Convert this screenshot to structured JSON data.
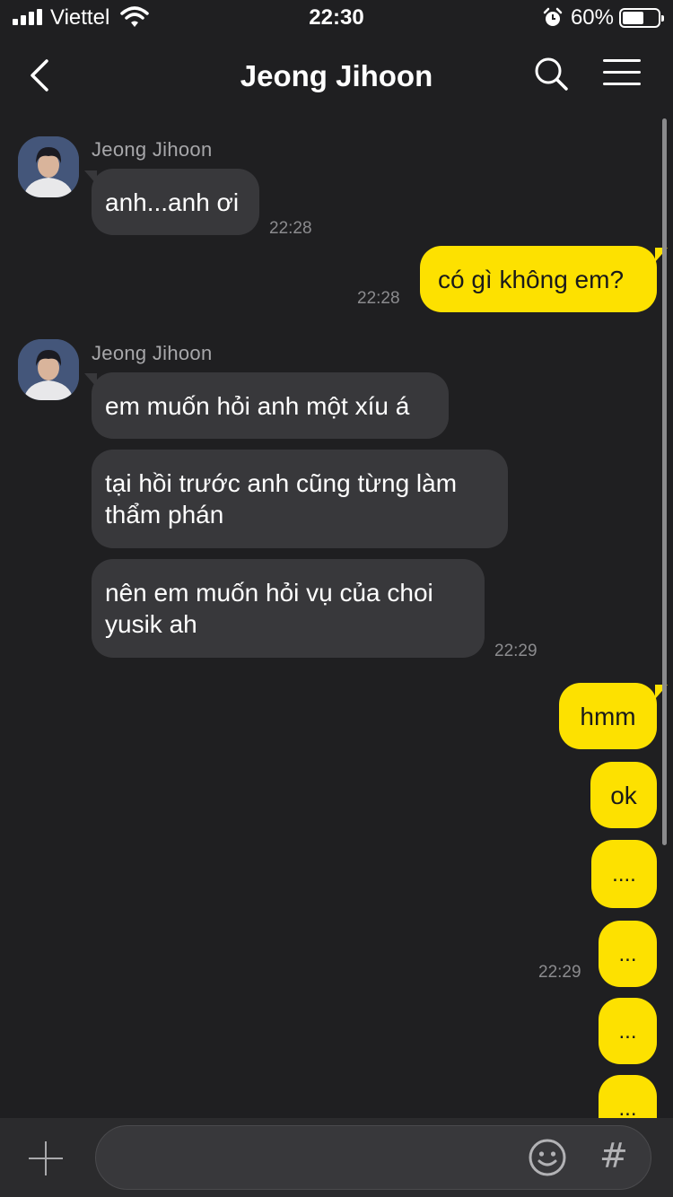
{
  "status_bar": {
    "carrier": "Viettel",
    "time": "22:30",
    "battery_percent": "60%",
    "battery_level": 0.6,
    "icons": [
      "signal-icon",
      "wifi-icon",
      "alarm-icon",
      "battery-icon"
    ]
  },
  "header": {
    "title": "Jeong Jihoon",
    "icons": [
      "back-arrow-icon",
      "search-icon",
      "menu-icon"
    ]
  },
  "messages": [
    {
      "sender": "Jeong Jihoon",
      "direction": "in",
      "text": "anh...anh ơi",
      "time": "22:28"
    },
    {
      "direction": "out",
      "text": "có gì không em?",
      "time": "22:28"
    },
    {
      "sender": "Jeong Jihoon",
      "direction": "in",
      "text": "em muốn hỏi anh một xíu á"
    },
    {
      "direction": "in",
      "text": "tại hồi trước anh cũng từng làm thẩm phán"
    },
    {
      "direction": "in",
      "text": "nên em muốn hỏi vụ của choi yusik ah",
      "time": "22:29"
    },
    {
      "direction": "out",
      "text": "hmm"
    },
    {
      "direction": "out",
      "text": "ok"
    },
    {
      "direction": "out",
      "text": "...."
    },
    {
      "direction": "out",
      "text": "...",
      "time": "22:29"
    },
    {
      "direction": "out",
      "text": "..."
    },
    {
      "direction": "out",
      "text": "..."
    }
  ],
  "input_bar": {
    "placeholder": "",
    "icons": [
      "plus-icon",
      "emoji-icon",
      "hashtag-icon"
    ],
    "hashtag_glyph": "#"
  },
  "colors": {
    "background": "#1f1f21",
    "incoming_bubble": "#38383b",
    "outgoing_bubble": "#fde100",
    "timestamp": "#8b8b8e"
  }
}
